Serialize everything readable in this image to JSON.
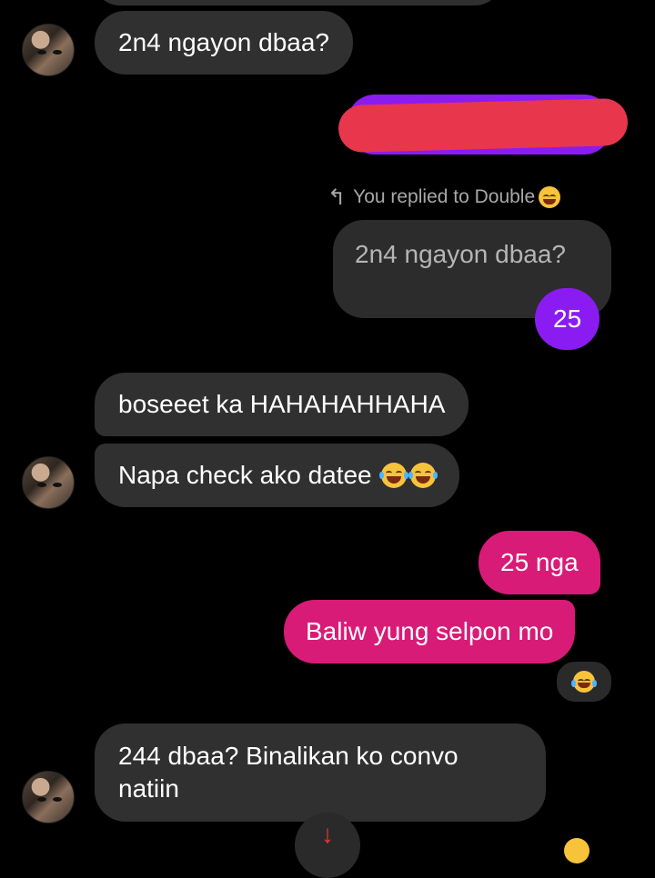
{
  "messages": {
    "m1": "2n4 ngayon dbaa?",
    "reply_label": "You replied to Double",
    "quoted": "2n4 ngayon dbaa?",
    "reply_text": "25",
    "m2": "boseeet ka HAHAHAHHAHA",
    "m3": "Napa check ako datee",
    "m4": "25 nga",
    "m5": "Baliw yung selpon mo",
    "m6": "244 dbaa? Binalikan ko convo natiin"
  },
  "colors": {
    "incoming": "#303030",
    "outgoing_purple": "#8a1cf2",
    "outgoing_pink": "#d81b77",
    "redaction": "#e8364c"
  }
}
